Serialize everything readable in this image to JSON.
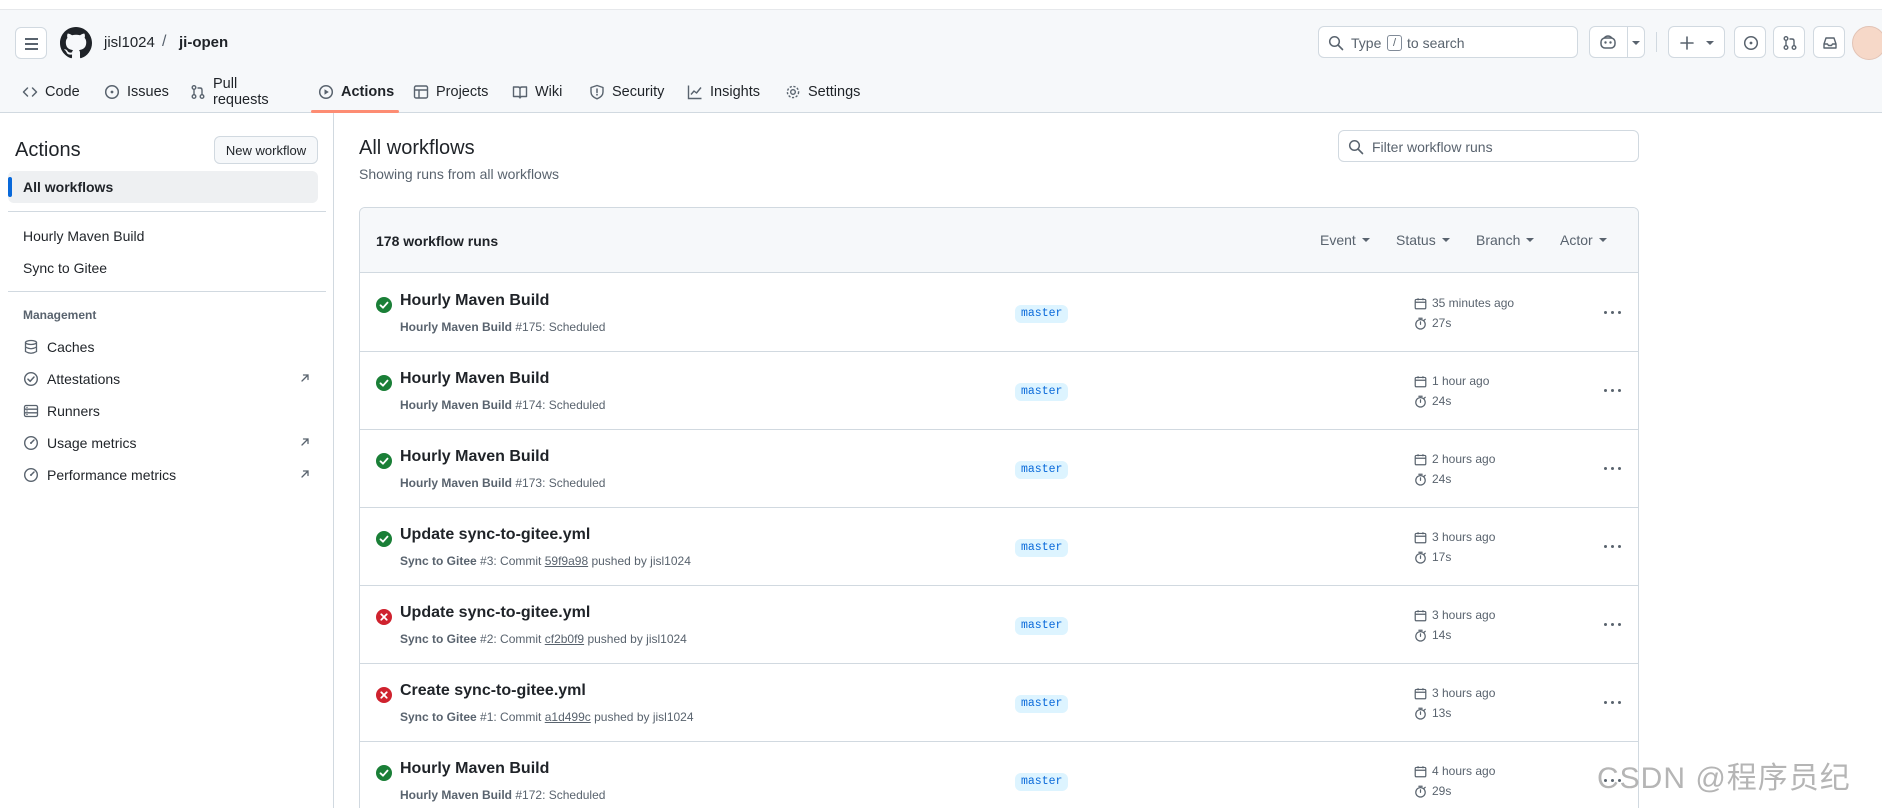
{
  "breadcrumb": {
    "owner": "jisl1024",
    "separator": "/",
    "repo": "ji-open"
  },
  "search": {
    "prefix": "Type",
    "key": "/",
    "suffix": "to search"
  },
  "repo_tabs": [
    {
      "label": "Code",
      "icon": "code-icon"
    },
    {
      "label": "Issues",
      "icon": "issue-icon"
    },
    {
      "label": "Pull requests",
      "icon": "pull-request-icon"
    },
    {
      "label": "Actions",
      "icon": "play-icon",
      "active": true
    },
    {
      "label": "Projects",
      "icon": "table-icon"
    },
    {
      "label": "Wiki",
      "icon": "book-icon"
    },
    {
      "label": "Security",
      "icon": "shield-icon"
    },
    {
      "label": "Insights",
      "icon": "graph-icon"
    },
    {
      "label": "Settings",
      "icon": "gear-icon"
    }
  ],
  "sidebar": {
    "title": "Actions",
    "new_workflow": "New workflow",
    "all_workflows": "All workflows",
    "workflows": [
      "Hourly Maven Build",
      "Sync to Gitee"
    ],
    "management_heading": "Management",
    "management": [
      {
        "label": "Caches",
        "icon": "database-icon",
        "external": false
      },
      {
        "label": "Attestations",
        "icon": "verified-icon",
        "external": true
      },
      {
        "label": "Runners",
        "icon": "server-icon",
        "external": false
      },
      {
        "label": "Usage metrics",
        "icon": "meter-icon",
        "external": true
      },
      {
        "label": "Performance metrics",
        "icon": "meter-icon",
        "external": true
      }
    ]
  },
  "main": {
    "title": "All workflows",
    "subtitle": "Showing runs from all workflows",
    "filter_placeholder": "Filter workflow runs",
    "runs_count": "178 workflow runs",
    "filters": [
      "Event",
      "Status",
      "Branch",
      "Actor"
    ]
  },
  "runs": [
    {
      "status": "success",
      "title": "Hourly Maven Build",
      "workflow": "Hourly Maven Build",
      "number": "#175",
      "detail": ": Scheduled",
      "sha": "",
      "pushed_by": "",
      "branch": "master",
      "when": "35 minutes ago",
      "duration": "27s"
    },
    {
      "status": "success",
      "title": "Hourly Maven Build",
      "workflow": "Hourly Maven Build",
      "number": "#174",
      "detail": ": Scheduled",
      "sha": "",
      "pushed_by": "",
      "branch": "master",
      "when": "1 hour ago",
      "duration": "24s"
    },
    {
      "status": "success",
      "title": "Hourly Maven Build",
      "workflow": "Hourly Maven Build",
      "number": "#173",
      "detail": ": Scheduled",
      "sha": "",
      "pushed_by": "",
      "branch": "master",
      "when": "2 hours ago",
      "duration": "24s"
    },
    {
      "status": "success",
      "title": "Update sync-to-gitee.yml",
      "workflow": "Sync to Gitee",
      "number": "#3",
      "detail": ": Commit ",
      "sha": "59f9a98",
      "pushed_by": " pushed by jisl1024",
      "branch": "master",
      "when": "3 hours ago",
      "duration": "17s"
    },
    {
      "status": "failure",
      "title": "Update sync-to-gitee.yml",
      "workflow": "Sync to Gitee",
      "number": "#2",
      "detail": ": Commit ",
      "sha": "cf2b0f9",
      "pushed_by": " pushed by jisl1024",
      "branch": "master",
      "when": "3 hours ago",
      "duration": "14s"
    },
    {
      "status": "failure",
      "title": "Create sync-to-gitee.yml",
      "workflow": "Sync to Gitee",
      "number": "#1",
      "detail": ": Commit ",
      "sha": "a1d499c",
      "pushed_by": " pushed by jisl1024",
      "branch": "master",
      "when": "3 hours ago",
      "duration": "13s"
    },
    {
      "status": "success",
      "title": "Hourly Maven Build",
      "workflow": "Hourly Maven Build",
      "number": "#172",
      "detail": ": Scheduled",
      "sha": "",
      "pushed_by": "",
      "branch": "master",
      "when": "4 hours ago",
      "duration": "29s"
    }
  ],
  "watermark": "CSDN @程序员纪",
  "colors": {
    "success": "#1a7f37",
    "failure": "#cf222e",
    "accent": "#0969da",
    "tab_underline": "#fd8c73"
  }
}
